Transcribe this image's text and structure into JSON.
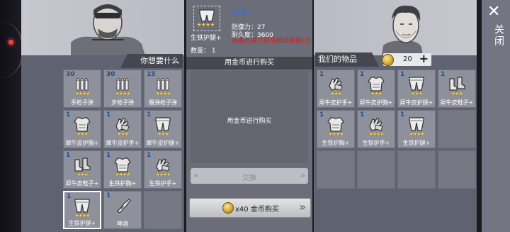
{
  "close_label": "关闭",
  "close_icon": "close-icon",
  "left": {
    "header": "你想要什么",
    "items": [
      {
        "count": "30",
        "name": "手枪子弹",
        "stars": "★★★★",
        "icon": "ammo-icon"
      },
      {
        "count": "30",
        "name": "步枪子弹",
        "stars": "★★★★",
        "icon": "ammo-icon"
      },
      {
        "count": "15",
        "name": "霰弹枪子弹",
        "stars": "★★★★",
        "icon": "ammo-icon"
      },
      {
        "count": "1",
        "name": "犀牛皮护胸+",
        "stars": "★★★",
        "icon": "chest-armor-icon"
      },
      {
        "count": "1",
        "name": "犀牛皮护手+",
        "stars": "★★★",
        "icon": "glove-icon"
      },
      {
        "count": "1",
        "name": "犀牛皮护腿+",
        "stars": "★★★",
        "icon": "leg-armor-icon"
      },
      {
        "count": "1",
        "name": "犀牛皮鞋子+",
        "stars": "★★★",
        "icon": "boots-icon"
      },
      {
        "count": "1",
        "name": "生铁护胸+",
        "stars": "★★★★",
        "icon": "chest-armor-icon"
      },
      {
        "count": "1",
        "name": "生铁护手+",
        "stars": "★★★★",
        "icon": "glove-icon"
      },
      {
        "count": "1",
        "name": "生铁护腿+",
        "stars": "★★★★",
        "icon": "leg-armor-icon"
      },
      {
        "count": "1",
        "name": "啤酒",
        "stars": "",
        "icon": "bottle-icon"
      },
      {
        "count": "",
        "name": "",
        "stars": "",
        "icon": ""
      }
    ]
  },
  "detail": {
    "tag": "[装备]",
    "item_name": "生铁护腿+",
    "stars": "★★★★",
    "defense": "防御力：27",
    "durability": "耐久度：3600",
    "warning": "装备后减少自身移动速度15",
    "quantity": "数量：  1"
  },
  "mid": {
    "header": "用金币进行购买",
    "body": "用金币进行购买",
    "exchange_label": "交换",
    "buy_label": "x40 金币购买"
  },
  "right": {
    "header": "我们的物品",
    "gold": "20",
    "plus": "+",
    "items": [
      {
        "count": "1",
        "name": "犀牛皮护手+",
        "stars": "★★★",
        "icon": "glove-icon"
      },
      {
        "count": "1",
        "name": "犀牛皮护胸+",
        "stars": "★★★",
        "icon": "chest-armor-icon"
      },
      {
        "count": "1",
        "name": "犀牛皮护腿+",
        "stars": "★★★",
        "icon": "leg-armor-icon"
      },
      {
        "count": "1",
        "name": "犀牛皮鞋子+",
        "stars": "★★★",
        "icon": "boots-icon"
      },
      {
        "count": "1",
        "name": "生铁护胸+",
        "stars": "★★★★",
        "icon": "chest-armor-icon"
      },
      {
        "count": "1",
        "name": "生铁护手+",
        "stars": "★★★★",
        "icon": "glove-icon"
      },
      {
        "count": "1",
        "name": "生铁护腿+",
        "stars": "★★★★",
        "icon": "leg-armor-icon"
      },
      {
        "count": "",
        "name": "",
        "stars": "",
        "icon": ""
      },
      {
        "count": "",
        "name": "",
        "stars": "",
        "icon": ""
      },
      {
        "count": "",
        "name": "",
        "stars": "",
        "icon": ""
      },
      {
        "count": "",
        "name": "",
        "stars": "",
        "icon": ""
      },
      {
        "count": "",
        "name": "",
        "stars": "",
        "icon": ""
      }
    ]
  }
}
